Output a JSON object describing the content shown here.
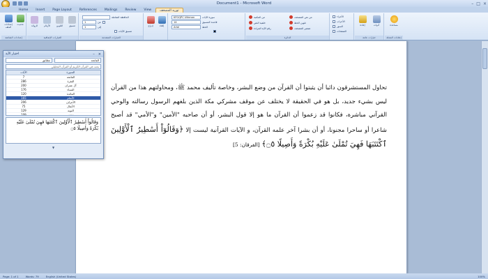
{
  "window": {
    "title": "Document1 - Microsoft Word",
    "controls": [
      "–",
      "□",
      "×"
    ]
  },
  "tabs": [
    "Home",
    "Insert",
    "Page Layout",
    "References",
    "Mailings",
    "Review",
    "View",
    "توريد المصحف"
  ],
  "ribbon": {
    "groups": [
      {
        "label": "إعدادات الشاشة",
        "buttons": [
          "إعدادات الملف",
          "تحديث"
        ]
      },
      {
        "label": "الخيارات الإضافية",
        "buttons": [
          "الزوائد",
          "الأرقام",
          "التلوين",
          "تنسيق"
        ]
      },
      {
        "label": "الخيارات المتقدمة",
        "rows": [
          "الحافظة الشاملة",
          "من",
          "إلى"
        ],
        "combo1": "1",
        "combo2": "1",
        "check": "تنسيق الآيات"
      },
      {
        "label": "",
        "buttons": [
          "إدراج",
          "إلغاء"
        ]
      },
      {
        "label": "الخيارات",
        "rows": [
          "سورة الآيات",
          "قاعدة التنسيق",
          "الخط"
        ],
        "combo1": "KFGQPC Uthman",
        "combo2": "14",
        "combo3": "Arial"
      },
      {
        "label": "الدائرة",
        "items": [
          "من المكتبة",
          "من نص المصحف",
          "خلفية النص",
          "تلوين الخط",
          "رقم الآية المرادة",
          "تصغير المصحف"
        ]
      },
      {
        "label": "",
        "checks": [
          "الأجزاء",
          "الأحزاب",
          "السور",
          "الصفحات"
        ]
      },
      {
        "label": "خيارات عامة",
        "buttons": [
          "إعادة",
          "أدوات"
        ]
      },
      {
        "label": "إعلانات المجلة",
        "buttons": [
          "مساعدة"
        ]
      }
    ]
  },
  "panel": {
    "title": "اختيار الآية",
    "combo_right": "الفاتحة",
    "combo_left": "مطابق",
    "search_placeholder": "بحث في القرآن الكريم أو القرآن التحليلي",
    "columns": [
      "السورة",
      "الآيات"
    ],
    "rows": [
      [
        "الفاتحة",
        "7"
      ],
      [
        "البقرة",
        "286"
      ],
      [
        "آل عمران",
        "200"
      ],
      [
        "النساء",
        "176"
      ],
      [
        "المائدة",
        "120"
      ],
      [
        "الأنعام",
        "165"
      ],
      [
        "الأعراف",
        "206"
      ],
      [
        "الأنفال",
        "75"
      ],
      [
        "التوبة",
        "129"
      ],
      [
        "يونس",
        "109"
      ],
      [
        "هود",
        "123"
      ]
    ],
    "selected_row": 5,
    "preview": "وَقَالُوٓاْ أَسَٰطِيرُ ٱلْأَوَّلِينَ ٱكْتَتَبَهَا فَهِيَ تُمْلَىٰ عَلَيْهِ بُكْرَةً وَأَصِيلًا ۝٥",
    "zoom_label": "▼"
  },
  "document": {
    "paragraph": "تحاول المستشرقون دائبا أن يثبتوا أن القرآن من وضع البشر، وخاصة تأليف محمد ﷺ، ومحاولتهم هذا من القرآن ليس بشيء جديد، بل هو في الحقيقة لا يختلف عن موقف مشركي مكة الذين بلغهم الرسول رسالته والوحي القرآني مباشرة، فكانوا قد زعموا أن القرآن ما هو إلا قول البشر، أو أن صاحبه \"الأمين\" و\"الأمي\" قد أصبح شاعرا أو ساحرا مجنونا، أو أن بشرا آخر علمه القرآن، و الآيات القرآنية ليست إلا",
    "quran": "﴿وَقَالُوٓاْ أَسَٰطِيرُ ٱلْأَوَّلِينَ ٱكْتَتَبَهَا فَهِيَ تُمْلَىٰ عَلَيْهِ بُكْرَةً وَأَصِيلًا ۝٥﴾",
    "reference": "[الفرقان: 5]"
  },
  "status": {
    "page": "Page: 1 of 1",
    "words": "Words: 79",
    "language": "English (United States)",
    "zoom": "100%"
  }
}
